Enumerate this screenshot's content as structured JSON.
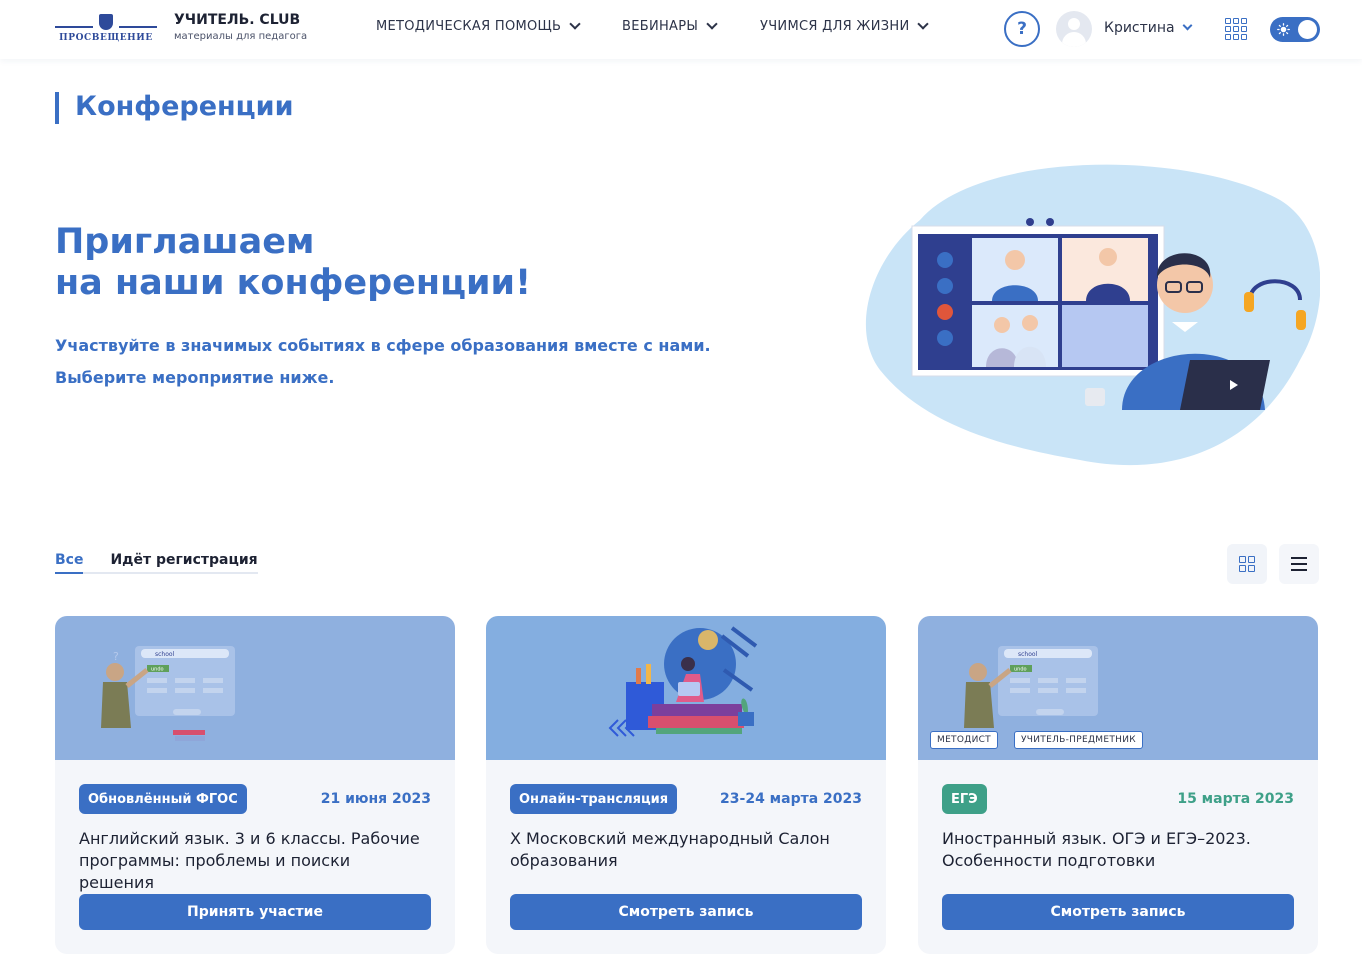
{
  "brand": {
    "logo_text": "ПРОСВЕЩЕНИЕ",
    "title": "УЧИТЕЛЬ. CLUB",
    "subtitle": "материалы для педагога"
  },
  "nav": {
    "items": [
      {
        "label": "МЕТОДИЧЕСКАЯ ПОМОЩЬ"
      },
      {
        "label": "ВЕБИНАРЫ"
      },
      {
        "label": "УЧИМСЯ ДЛЯ ЖИЗНИ"
      }
    ],
    "help_label": "?",
    "user_name": "Кристина"
  },
  "page": {
    "title": "Конференции"
  },
  "hero": {
    "title_line1": "Приглашаем",
    "title_line2": "на наши конференции!",
    "text_line1": "Участвуйте в значимых событиях в сфере образования вместе с нами.",
    "text_line2": "Выберите мероприятие ниже."
  },
  "tabs": [
    {
      "label": "Все",
      "active": true
    },
    {
      "label": "Идёт регистрация",
      "active": false
    }
  ],
  "cards": [
    {
      "badge": "Обновлённый ФГОС",
      "badge_color": "#3a6fc4",
      "date": "21 июня 2023",
      "title": "Английский язык. 3 и 6 классы. Рабочие программы: проблемы и поиски решения",
      "button": "Принять участие",
      "search_text": "school",
      "screen_word": "undo"
    },
    {
      "badge": "Онлайн-трансляция",
      "badge_color": "#3a6fc4",
      "date": "23-24 марта 2023",
      "title": "X Московский международный Салон образования",
      "button": "Смотреть запись"
    },
    {
      "badge": "ЕГЭ",
      "badge_color": "#3ea088",
      "date": "15 марта 2023",
      "title": "Иностранный язык. ОГЭ и ЕГЭ–2023. Особенности подготовки",
      "button": "Смотреть запись",
      "tags": [
        "МЕТОДИСТ",
        "УЧИТЕЛЬ-ПРЕДМЕТНИК"
      ],
      "search_text": "school",
      "screen_word": "undo"
    }
  ],
  "colors": {
    "accent": "#3a6fc4",
    "green": "#3ea088",
    "card_bg": "#f4f6fa"
  }
}
